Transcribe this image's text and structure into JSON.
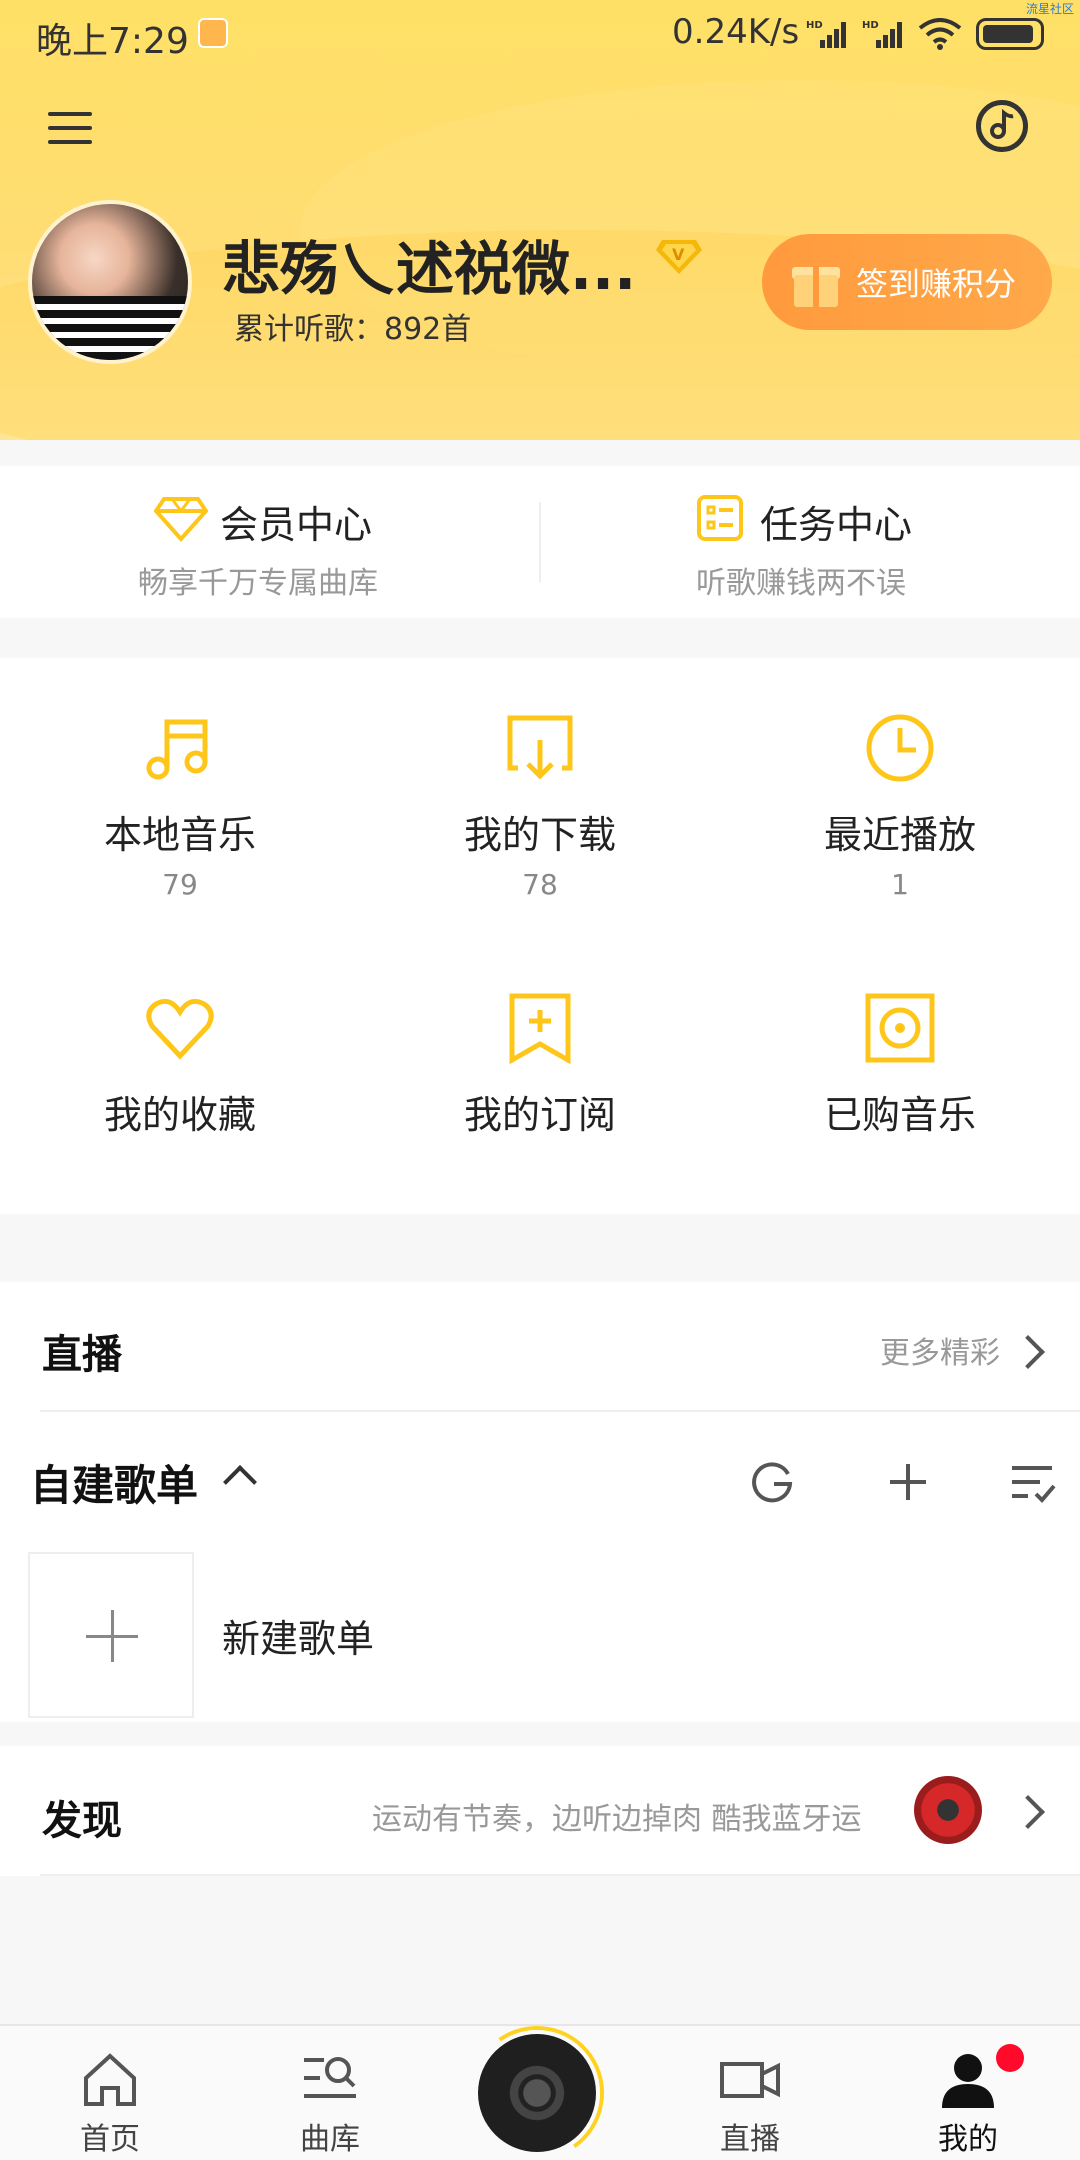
{
  "status_bar": {
    "time": "晚上7:29",
    "speed": "0.24K/s",
    "signal_label": "HD",
    "corner_text": "流星社区"
  },
  "profile": {
    "username": "悲殇乀述祱微...",
    "listen_count": "累计听歌：892首",
    "vip_badge": "V",
    "checkin_label": "签到赚积分"
  },
  "vip_row": {
    "member": {
      "title": "会员中心",
      "subtitle": "畅享千万专属曲库"
    },
    "task": {
      "title": "任务中心",
      "subtitle": "听歌赚钱两不误"
    }
  },
  "grid": [
    {
      "label": "本地音乐",
      "count": "79",
      "icon": "music-note-icon"
    },
    {
      "label": "我的下载",
      "count": "78",
      "icon": "download-icon"
    },
    {
      "label": "最近播放",
      "count": "1",
      "icon": "clock-icon"
    },
    {
      "label": "我的收藏",
      "count": "",
      "icon": "heart-icon"
    },
    {
      "label": "我的订阅",
      "count": "",
      "icon": "bookmark-plus-icon"
    },
    {
      "label": "已购音乐",
      "count": "",
      "icon": "purchased-disc-icon"
    }
  ],
  "live": {
    "title": "直播",
    "more": "更多精彩"
  },
  "playlists": {
    "title": "自建歌单",
    "new_label": "新建歌单"
  },
  "discover": {
    "title": "发现",
    "text": "运动有节奏，边听边掉肉 酷我蓝牙运"
  },
  "bottom_nav": [
    {
      "label": "首页",
      "icon": "home-icon"
    },
    {
      "label": "曲库",
      "icon": "library-search-icon"
    },
    {
      "label": "",
      "icon": "now-playing-disc-icon"
    },
    {
      "label": "直播",
      "icon": "video-camera-icon"
    },
    {
      "label": "我的",
      "icon": "user-icon"
    }
  ],
  "colors": {
    "accent_yellow": "#ffd21f",
    "checkin_orange": "#ff9a3d",
    "notification_red": "#ff0a2b"
  }
}
